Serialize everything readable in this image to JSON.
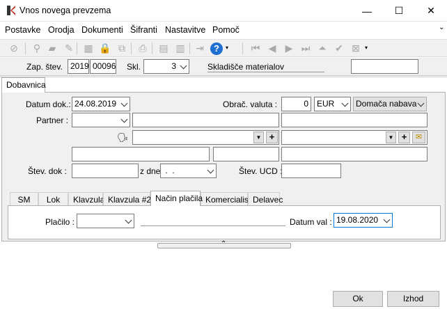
{
  "window": {
    "title": "Vnos novega prevzema",
    "minimize": "—",
    "maximize": "☐",
    "close": "✕"
  },
  "menu": [
    "Postavke",
    "Orodja",
    "Dokumenti",
    "Šifranti",
    "Nastavitve",
    "Pomoč"
  ],
  "header": {
    "zap_label": "Zap. štev.",
    "zap_year": "2019",
    "zap_num": "00096",
    "skl_label": "Skl.",
    "skl_value": "3",
    "skl_name": "Skladišče materialov",
    "extra_value": ""
  },
  "main_tab": "Dobavnica",
  "form": {
    "datum_label": "Datum dok.:",
    "datum_value": "24.08.2019",
    "valuta_label": "Obrač. valuta :",
    "valuta_rate": "0",
    "valuta_code": "EUR",
    "nabava_type": "Domača nabava",
    "partner_label": "Partner :",
    "stev_dok_label": "Štev. dok :",
    "z_dne_label": "z dne",
    "z_dne_value": " .  .",
    "stev_ucd_label": "Štev. UCD :"
  },
  "sub_tabs": [
    "SM",
    "Lok",
    "Klavzula",
    "Klavzula #2",
    "Način plačila",
    "Komercialist",
    "Delavec"
  ],
  "payment": {
    "placilo_label": "Plačilo :",
    "placilo_value": "",
    "datum_val_label": "Datum val :",
    "datum_val_value": "19.08.2020"
  },
  "buttons": {
    "ok": "Ok",
    "izhod": "Izhod"
  },
  "colors": {
    "accent": "#0078d7",
    "panel": "#f0f0f0"
  }
}
